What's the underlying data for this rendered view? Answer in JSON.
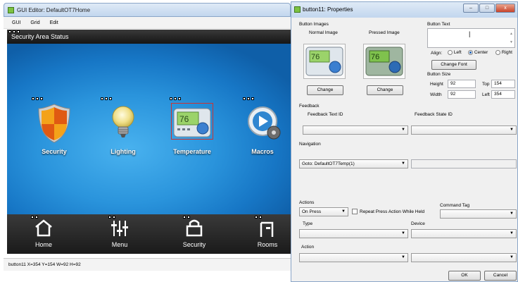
{
  "editor": {
    "title": "GUI Editor: DefaultOT7Home",
    "menu": [
      "GUI",
      "Grid",
      "Edit"
    ],
    "header_title": "Security Area Status",
    "tiles": [
      {
        "label": "Security",
        "icon": "shield-icon"
      },
      {
        "label": "Lighting",
        "icon": "lightbulb-icon"
      },
      {
        "label": "Temperature",
        "icon": "thermostat-icon",
        "readout": "76"
      },
      {
        "label": "Macros",
        "icon": "play-gear-icon"
      }
    ],
    "nav": [
      {
        "label": "Home",
        "icon": "home-icon"
      },
      {
        "label": "Menu",
        "icon": "menu-sliders-icon"
      },
      {
        "label": "Security",
        "icon": "security-icon"
      },
      {
        "label": "Rooms",
        "icon": "rooms-icon"
      }
    ],
    "status": "button11 X=354 Y=154 W=92 H=92"
  },
  "dialog": {
    "title": "button11: Properties",
    "window_buttons": {
      "minimize": "–",
      "maximize": "□",
      "close": "x"
    },
    "button_images": "Button Images",
    "normal_image": "Normal Image",
    "pressed_image": "Pressed Image",
    "image_readout": "76",
    "change": "Change",
    "button_text": "Button Text",
    "align_label": "Align:",
    "align_options": [
      "Left",
      "Center",
      "Right"
    ],
    "align_selected": "Center",
    "change_font": "Change Font",
    "button_size": "Button Size",
    "height_label": "Height",
    "height_value": "92",
    "width_label": "Width",
    "width_value": "92",
    "top_label": "Top",
    "top_value": "154",
    "left_label": "Left",
    "left_value": "354",
    "feedback": "Feedback",
    "feedback_text_id": "Feedback Text ID",
    "feedback_state_id": "Feedback State ID",
    "navigation": "Navigation",
    "navigation_value": "Goto: DefaultOT7Temp(1)",
    "actions": "Actions",
    "actions_value": "On Press",
    "repeat_label": "Repeat Press Action While Held",
    "command_tag": "Command Tag",
    "type": "Type",
    "device": "Device",
    "action": "Action",
    "ok": "OK",
    "cancel": "Cancel"
  },
  "colors": {
    "canvas_blue": "#1c84d2",
    "tile_text": "#ffffff",
    "select_blue": "#1b5fb5"
  }
}
